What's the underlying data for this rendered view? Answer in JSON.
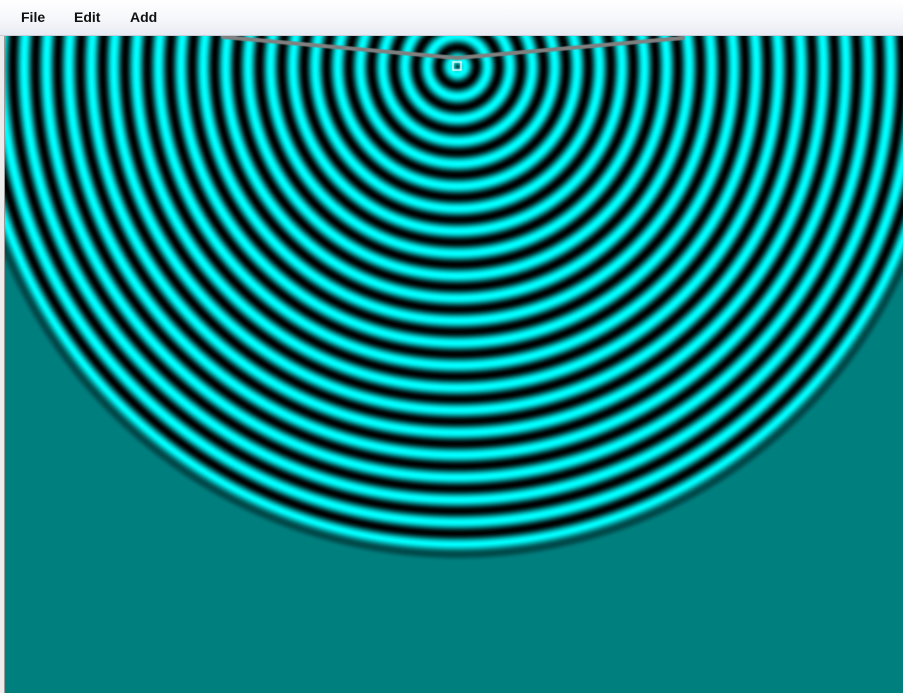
{
  "menubar": {
    "items": [
      {
        "label": "File"
      },
      {
        "label": "Edit"
      },
      {
        "label": "Add"
      }
    ]
  },
  "simulation": {
    "medium_color": "#007f7f",
    "crest_color": "#00ffff",
    "trough_color": "#000000",
    "barrier_color": "#808080",
    "source_marker_color": "#ffffff",
    "source_icon": "point-source-icon"
  }
}
